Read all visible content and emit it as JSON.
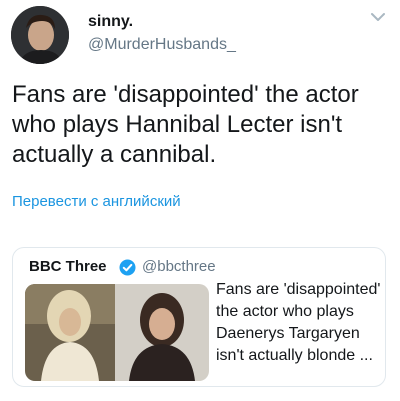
{
  "tweet": {
    "author_name": "sinny.",
    "author_handle": "@MurderHusbands_",
    "text": "Fans are 'disappointed' the actor who plays Hannibal Lecter isn't actually a cannibal.",
    "translate_link": "Перевести с английский"
  },
  "quote": {
    "author_name": "BBC Three",
    "author_handle": "@bbcthree",
    "text": "Fans are 'disappointed' the actor who plays Daenerys Targaryen isn't actually blonde ..."
  },
  "colors": {
    "link": "#1b95e0",
    "verified": "#1da1f2",
    "secondary_text": "#657786",
    "border": "#e1e8ed"
  },
  "icons": {
    "menu": "chevron-down-icon",
    "verified": "verified-badge-icon"
  }
}
